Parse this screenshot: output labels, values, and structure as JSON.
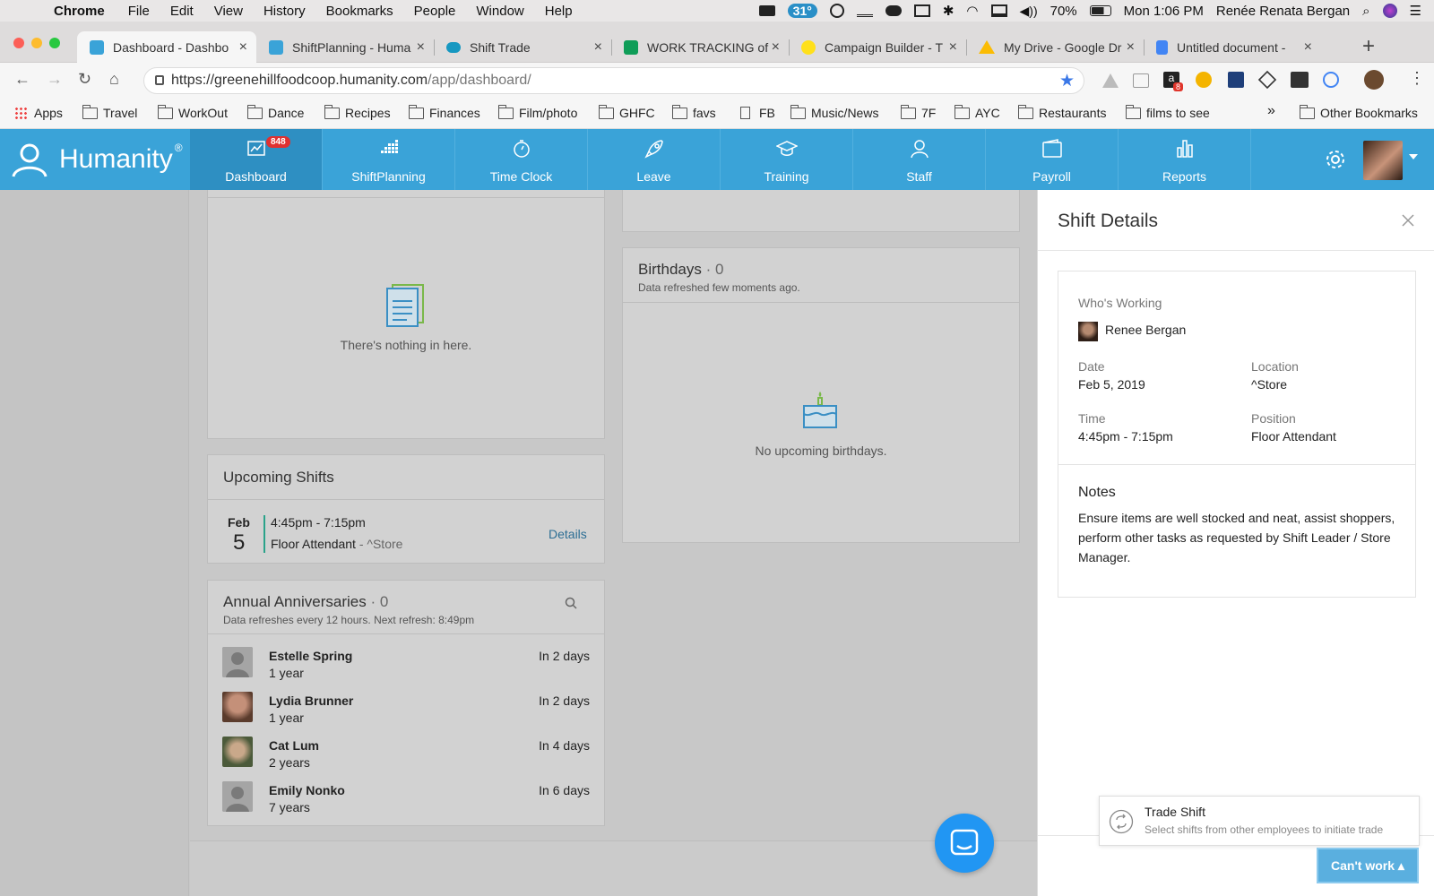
{
  "menubar": {
    "app": "Chrome",
    "menus": [
      "File",
      "Edit",
      "View",
      "History",
      "Bookmarks",
      "People",
      "Window",
      "Help"
    ],
    "temperature": "31°",
    "battery": "70%",
    "clock": "Mon 1:06 PM",
    "user": "Renée Renata Bergan"
  },
  "tabs": [
    {
      "title": "Dashboard - Dashbo",
      "color": "#3aa3d8"
    },
    {
      "title": "ShiftPlanning - Huma",
      "color": "#3aa3d8"
    },
    {
      "title": "Shift Trade",
      "color": "#1798c1"
    },
    {
      "title": "WORK TRACKING of",
      "color": "#0f9d58"
    },
    {
      "title": "Campaign Builder - T",
      "color": "#ffe01b"
    },
    {
      "title": "My Drive - Google Dr",
      "color": "#fbbc04"
    },
    {
      "title": "Untitled document -",
      "color": "#4285f4"
    }
  ],
  "address": {
    "host": "https://greenehillfoodcoop.humanity.com",
    "path": "/app/dashboard/",
    "ext_badge": "8"
  },
  "bookmarks": {
    "apps": "Apps",
    "items": [
      "Travel",
      "WorkOut",
      "Dance",
      "Recipes",
      "Finances",
      "Film/photo",
      "GHFC",
      "favs",
      "FB",
      "Music/News",
      "7F",
      "AYC",
      "Restaurants",
      "films to see"
    ],
    "more": "»",
    "other": "Other Bookmarks"
  },
  "header": {
    "logo": "Humanity",
    "reg": "®",
    "nav": [
      {
        "label": "Dashboard",
        "badge": "848"
      },
      {
        "label": "ShiftPlanning"
      },
      {
        "label": "Time Clock"
      },
      {
        "label": "Leave"
      },
      {
        "label": "Training"
      },
      {
        "label": "Staff"
      },
      {
        "label": "Payroll"
      },
      {
        "label": "Reports"
      }
    ]
  },
  "empty_card": {
    "text": "There's nothing in here."
  },
  "upcoming": {
    "title": "Upcoming Shifts",
    "month": "Feb",
    "day": "5",
    "time": "4:45pm - 7:15pm",
    "position": "Floor Attendant",
    "location": " - ^Store",
    "details": "Details"
  },
  "anniversaries": {
    "title": "Annual Anniversaries",
    "count": " · 0",
    "subtitle": "Data refreshes every 12 hours. Next refresh: 8:49pm",
    "rows": [
      {
        "name": "Estelle Spring",
        "years": "1 year",
        "when": "In 2 days"
      },
      {
        "name": "Lydia Brunner",
        "years": "1 year",
        "when": "In 2 days"
      },
      {
        "name": "Cat Lum",
        "years": "2 years",
        "when": "In 4 days"
      },
      {
        "name": "Emily Nonko",
        "years": "7 years",
        "when": "In 6 days"
      }
    ]
  },
  "birthdays": {
    "title": "Birthdays",
    "count": " · 0",
    "subtitle": "Data refreshed few moments ago.",
    "empty": "No upcoming birthdays."
  },
  "shift_details": {
    "title": "Shift Details",
    "whos_working_label": "Who's Working",
    "worker": "Renee Bergan",
    "date_label": "Date",
    "date": "Feb 5, 2019",
    "location_label": "Location",
    "location": "^Store",
    "time_label": "Time",
    "time": "4:45pm - 7:15pm",
    "position_label": "Position",
    "position": "Floor Attendant",
    "notes_label": "Notes",
    "notes": "Ensure items are well stocked and neat, assist shoppers, perform other tasks as requested by Shift Leader / Store Manager."
  },
  "trade": {
    "title": "Trade Shift",
    "subtitle": "Select shifts from other employees to initiate trade",
    "cant_work": "Can't work ▴"
  }
}
